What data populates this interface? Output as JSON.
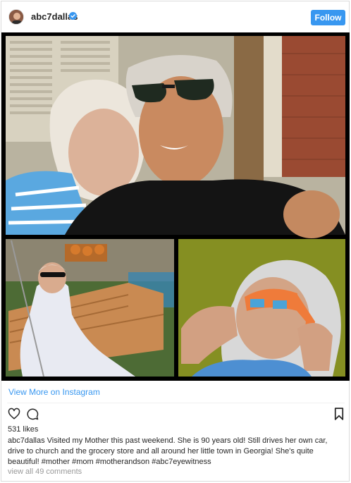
{
  "post": {
    "username": "abc7dallas",
    "follow_label": "Follow",
    "view_more_label": "View More on Instagram",
    "likes_text": "531 likes",
    "caption_user": "abc7dallas",
    "caption_text": "Visited my Mother this past weekend. She is 90 years old! Still drives her own car, drive to church and the grocery store and all around her little town in Georgia! She's quite beautiful! #mother #mom #motherandson #abc7eyewitness",
    "view_comments_label": "view all 49 comments"
  },
  "icons": {
    "verified": "verified-badge-icon",
    "like": "heart-icon",
    "comment": "comment-icon",
    "save": "bookmark-icon"
  },
  "colors": {
    "accent": "#3897f0",
    "text": "#262626",
    "muted": "#999999",
    "border": "#dbdbdb"
  }
}
